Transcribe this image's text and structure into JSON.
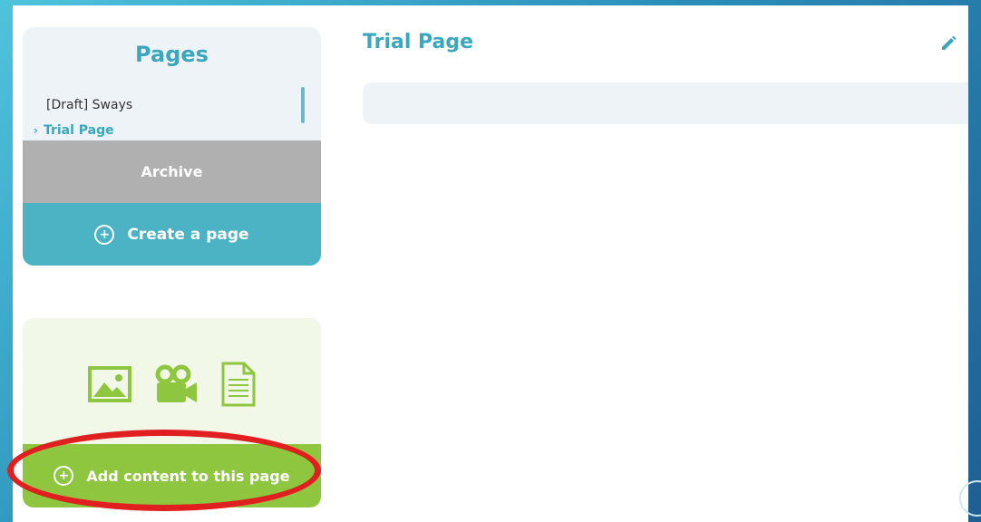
{
  "sidebar": {
    "title": "Pages",
    "pages": [
      {
        "label": "[Draft] Sways",
        "active": false
      },
      {
        "label": "Trial Page",
        "active": true
      }
    ],
    "active_chevron": "›",
    "archive_label": "Archive",
    "create_label": "Create a page"
  },
  "content_panel": {
    "icons": [
      "image-icon",
      "video-camera-icon",
      "document-icon"
    ],
    "add_label": "Add content to this page"
  },
  "main": {
    "title": "Trial Page"
  },
  "colors": {
    "accent": "#3aa7bd",
    "create_button": "#4bb3c3",
    "archive_button": "#b0b0b0",
    "add_button": "#8ec63f",
    "highlight": "#e02020"
  }
}
